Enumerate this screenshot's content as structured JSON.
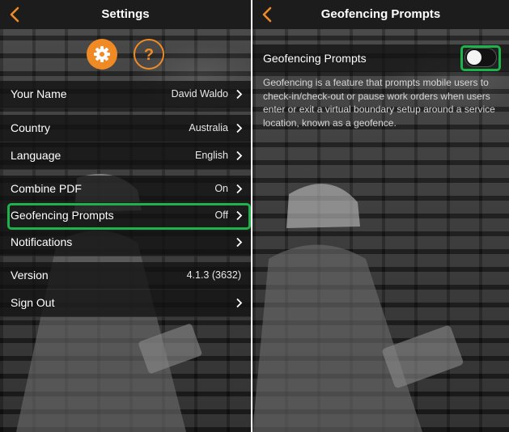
{
  "left_screen": {
    "nav": {
      "title": "Settings",
      "back_icon": "chevron-left-icon"
    },
    "top_icons": [
      {
        "name": "gear-icon",
        "active": true
      },
      {
        "name": "question-mark-icon",
        "glyph": "?",
        "active": false
      }
    ],
    "rows": [
      {
        "label": "Your Name",
        "value": "David Waldo",
        "chevron": true
      },
      {
        "label": "Country",
        "value": "Australia",
        "chevron": true
      },
      {
        "label": "Language",
        "value": "English",
        "chevron": true
      },
      {
        "label": "Combine PDF",
        "value": "On",
        "chevron": true
      },
      {
        "label": "Geofencing Prompts",
        "value": "Off",
        "chevron": true,
        "highlighted": true
      },
      {
        "label": "Notifications",
        "value": "",
        "chevron": true
      },
      {
        "label": "Version",
        "value": "4.1.3 (3632)",
        "chevron": false
      },
      {
        "label": "Sign Out",
        "value": "",
        "chevron": true
      }
    ]
  },
  "right_screen": {
    "nav": {
      "title": "Geofencing Prompts",
      "back_icon": "chevron-left-icon"
    },
    "setting": {
      "label": "Geofencing Prompts",
      "enabled": false,
      "highlighted": true
    },
    "description": "Geofencing is a feature that prompts mobile users to check-in/check-out or pause work orders when users enter or exit a virtual boundary setup around a service location, known as a geofence."
  },
  "colors": {
    "accent": "#f08a24",
    "highlight": "#1fb24a",
    "nav_bg": "#1c1c1c",
    "row_bg": "#121212",
    "text": "#ffffff"
  }
}
